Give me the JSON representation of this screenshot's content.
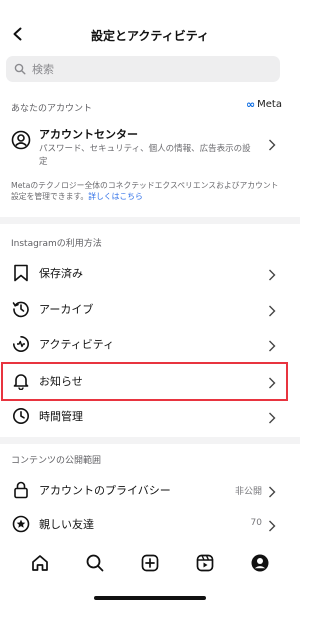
{
  "header": {
    "title": "設定とアクティビティ"
  },
  "search": {
    "placeholder": "検索"
  },
  "account_section": {
    "heading": "あなたのアカウント",
    "meta_label": "Meta",
    "account_center": {
      "title": "アカウントセンター",
      "subtitle": "パスワード、セキュリティ、個人の情報、広告表示の設定"
    },
    "description": "Metaのテクノロジー全体のコネクテッドエクスペリエンスおよびアカウント設定を管理できます。",
    "link": "詳しくはこちら"
  },
  "usage_section": {
    "heading": "Instagramの利用方法",
    "items": [
      {
        "label": "保存済み",
        "icon": "bookmark-icon"
      },
      {
        "label": "アーカイブ",
        "icon": "archive-icon"
      },
      {
        "label": "アクティビティ",
        "icon": "activity-icon"
      },
      {
        "label": "お知らせ",
        "icon": "bell-icon"
      },
      {
        "label": "時間管理",
        "icon": "clock-icon"
      }
    ]
  },
  "visibility_section": {
    "heading": "コンテンツの公開範囲",
    "items": [
      {
        "label": "アカウントのプライバシー",
        "value": "非公開",
        "icon": "lock-icon"
      },
      {
        "label": "親しい友達",
        "value": "70",
        "icon": "star-icon"
      }
    ]
  },
  "tabbar": [
    "home-icon",
    "search-icon",
    "create-icon",
    "reels-icon",
    "profile-icon"
  ],
  "colors": {
    "highlight": "#e8343f",
    "link": "#2e6fe8",
    "meta": "#0668e1"
  }
}
